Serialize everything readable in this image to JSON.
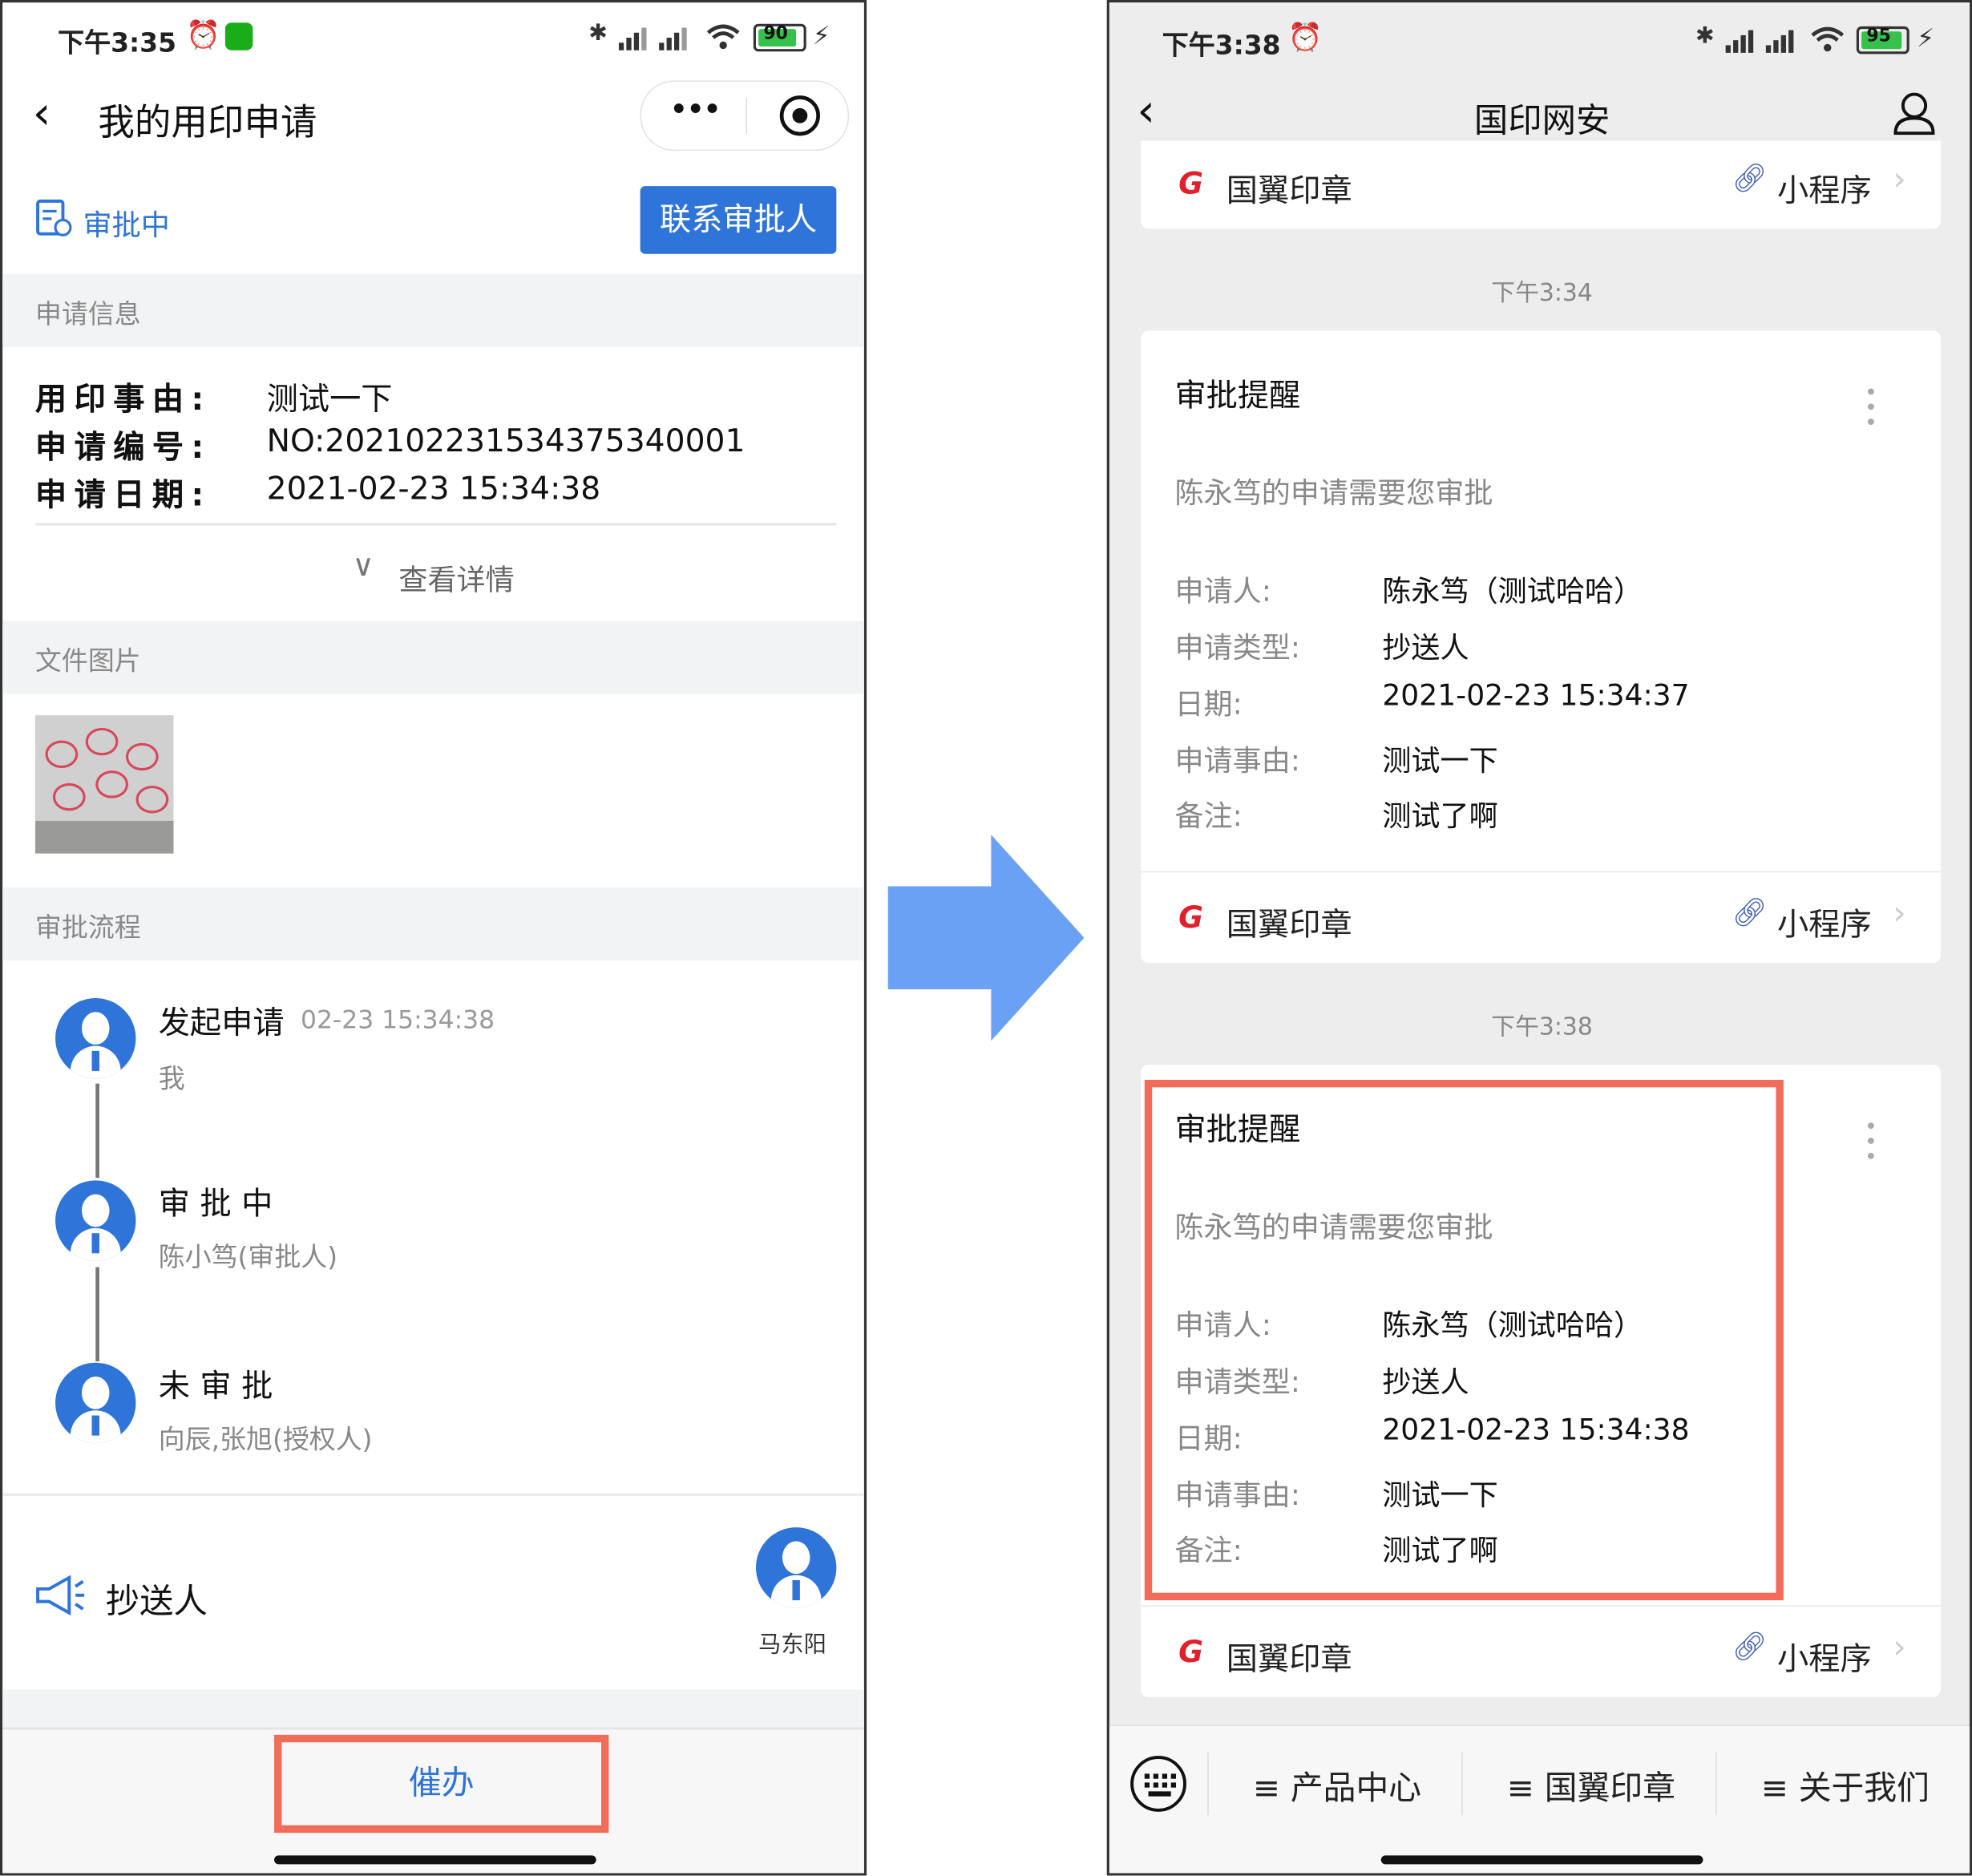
{
  "left_phone": {
    "status_bar": {
      "time": "下午3:35",
      "battery": "90"
    },
    "nav": {
      "title": "我的用印申请"
    },
    "status": {
      "label": "审批中",
      "contact_button": "联系审批人"
    },
    "sections": {
      "apply_info": "申请信息",
      "file_images": "文件图片",
      "approval_flow": "审批流程"
    },
    "apply_info": {
      "rows": [
        {
          "label": "用印事由:",
          "value": "测试一下"
        },
        {
          "label": "申请编号:",
          "value": "NO:202102231534375340001"
        },
        {
          "label": "申请日期:",
          "value": "2021-02-23 15:34:38"
        }
      ],
      "view_details": "查看详情"
    },
    "flow": [
      {
        "title": "发起申请",
        "time": "02-23 15:34:38",
        "person": "我"
      },
      {
        "title": "审 批 中",
        "time": "",
        "person": "陈小笃(审批人)"
      },
      {
        "title": "未 审 批",
        "time": "",
        "person": "向辰,张旭(授权人)"
      }
    ],
    "cc": {
      "label": "抄送人",
      "person": "马东阳"
    },
    "urge_button": "催办"
  },
  "right_phone": {
    "status_bar": {
      "time": "下午3:38",
      "battery": "95"
    },
    "nav": {
      "title": "国印网安"
    },
    "top_card": {
      "brand": "国翼印章",
      "mini": "小程序"
    },
    "messages": [
      {
        "time": "下午3:34",
        "title": "审批提醒",
        "subtitle": "陈永笃的申请需要您审批",
        "rows": [
          {
            "label": "申请人:",
            "value": "陈永笃（测试哈哈）"
          },
          {
            "label": "申请类型:",
            "value": "抄送人"
          },
          {
            "label": "日期:",
            "value": "2021-02-23 15:34:37"
          },
          {
            "label": "申请事由:",
            "value": "测试一下"
          },
          {
            "label": "备注:",
            "value": "测试了啊"
          }
        ],
        "brand": "国翼印章",
        "mini": "小程序"
      },
      {
        "time": "下午3:38",
        "title": "审批提醒",
        "subtitle": "陈永笃的申请需要您审批",
        "rows": [
          {
            "label": "申请人:",
            "value": "陈永笃（测试哈哈）"
          },
          {
            "label": "申请类型:",
            "value": "抄送人"
          },
          {
            "label": "日期:",
            "value": "2021-02-23 15:34:38"
          },
          {
            "label": "申请事由:",
            "value": "测试一下"
          },
          {
            "label": "备注:",
            "value": "测试了啊"
          }
        ],
        "brand": "国翼印章",
        "mini": "小程序"
      }
    ],
    "menu": [
      "≡ 产品中心",
      "≡ 国翼印章",
      "≡ 关于我们"
    ]
  },
  "colors": {
    "accent_blue": "#2f74d8",
    "highlight_red": "#f26c5a",
    "arrow_blue": "#6aa1f5",
    "brand_red": "#e0202a"
  }
}
